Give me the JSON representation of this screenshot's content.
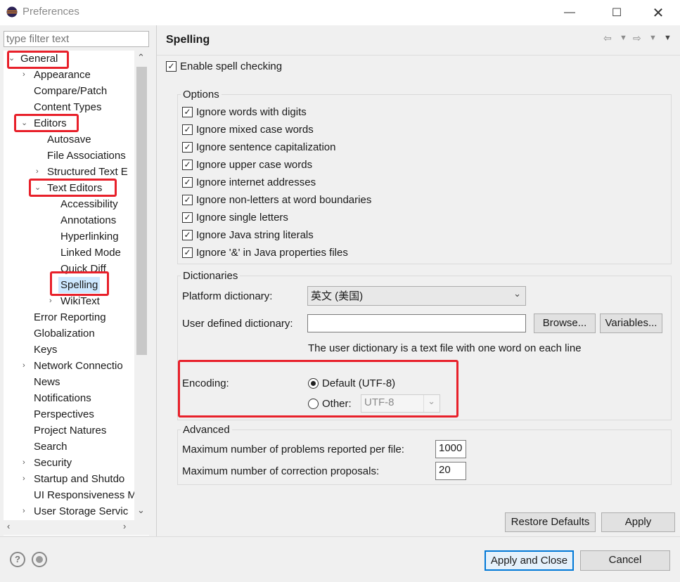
{
  "window": {
    "title": "Preferences",
    "minimize_icon": "minimize-icon",
    "maximize_icon": "maximize-icon",
    "close_icon": "close-icon"
  },
  "filter": {
    "placeholder": "type filter text"
  },
  "tree": {
    "items": [
      {
        "label": "General",
        "twisty": "expanded"
      },
      {
        "label": "Appearance",
        "twisty": "collapsed"
      },
      {
        "label": "Compare/Patch"
      },
      {
        "label": "Content Types"
      },
      {
        "label": "Editors",
        "twisty": "expanded"
      },
      {
        "label": "Autosave"
      },
      {
        "label": "File Associations"
      },
      {
        "label": "Structured Text E",
        "twisty": "collapsed"
      },
      {
        "label": "Text Editors",
        "twisty": "expanded"
      },
      {
        "label": "Accessibility"
      },
      {
        "label": "Annotations"
      },
      {
        "label": "Hyperlinking"
      },
      {
        "label": "Linked Mode"
      },
      {
        "label": "Quick Diff"
      },
      {
        "label": "Spelling",
        "selected": true
      },
      {
        "label": "WikiText",
        "twisty": "collapsed"
      },
      {
        "label": "Error Reporting"
      },
      {
        "label": "Globalization"
      },
      {
        "label": "Keys"
      },
      {
        "label": "Network Connectio",
        "twisty": "collapsed"
      },
      {
        "label": "News"
      },
      {
        "label": "Notifications"
      },
      {
        "label": "Perspectives"
      },
      {
        "label": "Project Natures"
      },
      {
        "label": "Search"
      },
      {
        "label": "Security",
        "twisty": "collapsed"
      },
      {
        "label": "Startup and Shutdo",
        "twisty": "collapsed"
      },
      {
        "label": "UI Responsiveness M"
      },
      {
        "label": "User Storage Servic",
        "twisty": "collapsed"
      }
    ]
  },
  "page": {
    "title": "Spelling",
    "enable_label": "Enable spell checking",
    "enable_checked": true,
    "options": {
      "title": "Options",
      "items": [
        {
          "label": "Ignore words with digits",
          "checked": true
        },
        {
          "label": "Ignore mixed case words",
          "checked": true
        },
        {
          "label": "Ignore sentence capitalization",
          "checked": true
        },
        {
          "label": "Ignore upper case words",
          "checked": true
        },
        {
          "label": "Ignore internet addresses",
          "checked": true
        },
        {
          "label": "Ignore non-letters at word boundaries",
          "checked": true
        },
        {
          "label": "Ignore single letters",
          "checked": true
        },
        {
          "label": "Ignore Java string literals",
          "checked": true
        },
        {
          "label": "Ignore '&' in Java properties files",
          "checked": true
        }
      ]
    },
    "dictionaries": {
      "title": "Dictionaries",
      "platform_label": "Platform dictionary:",
      "platform_value": "英文 (美国)",
      "user_label": "User defined dictionary:",
      "user_value": "",
      "browse": "Browse...",
      "variables": "Variables...",
      "hint": "The user dictionary is a text file with one word on each line",
      "encoding_label": "Encoding:",
      "default_label": "Default (UTF-8)",
      "other_label": "Other:",
      "other_value": "UTF-8",
      "selected": "default"
    },
    "advanced": {
      "title": "Advanced",
      "max_problems_label": "Maximum number of problems reported per file:",
      "max_problems": "1000",
      "max_proposals_label": "Maximum number of correction proposals:",
      "max_proposals": "20"
    },
    "restore_defaults": "Restore Defaults",
    "apply": "Apply"
  },
  "footer": {
    "help_icon": "help-icon",
    "import_export_icon": "import-export-icon",
    "apply_close": "Apply and Close",
    "cancel": "Cancel"
  },
  "colors": {
    "highlight": "#e8202a",
    "selection": "#cde8ff",
    "default_button_border": "#0078d7"
  }
}
